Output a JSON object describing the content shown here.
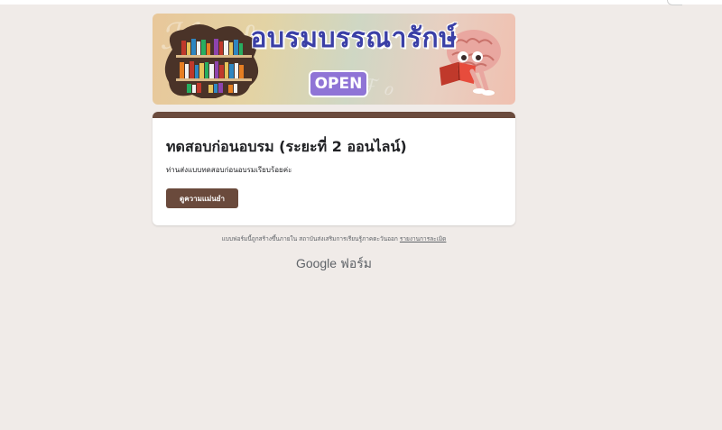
{
  "banner": {
    "title": "อบรมบรรณารักษ์",
    "badge": "OPEN"
  },
  "card": {
    "title": "ทดสอบก่อนอบรม (ระยะที่ 2 ออนไลน์)",
    "description": "ท่านส่งแบบทดสอบก่อนอบรมเรียบร้อยค่ะ",
    "view_score_label": "ดูความแม่นยำ",
    "accent_color": "#6a4a3c"
  },
  "footer": {
    "note": "แบบฟอร์มนี้ถูกสร้างขึ้นภายใน สถาบันส่งเสริมการเรียนรู้ภาคตะวันออก",
    "report_link": "รายงานการละเมิด",
    "brand": "Google ฟอร์ม"
  },
  "colors": {
    "page_background": "#f0ebe8",
    "banner_title": "#3a3fa6",
    "badge": "#8f74d6"
  }
}
